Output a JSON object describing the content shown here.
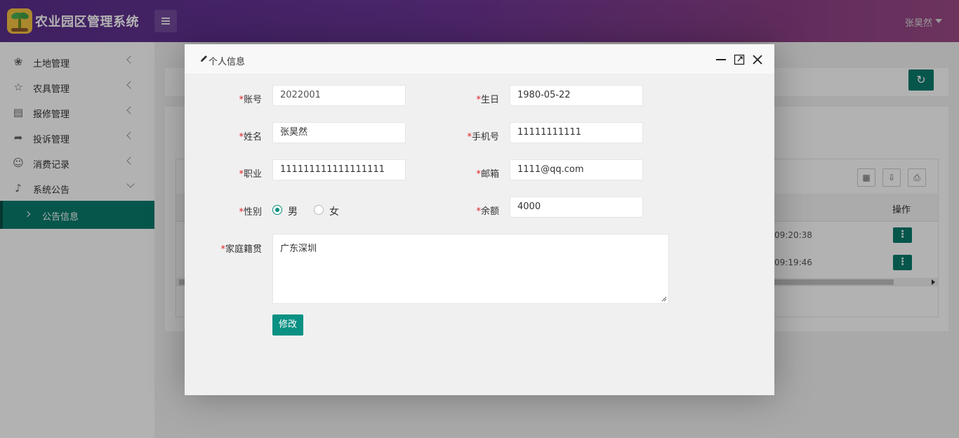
{
  "header": {
    "app_title": "农业园区管理系统",
    "user_name": "张昊然"
  },
  "sidebar": {
    "items": [
      {
        "label": "土地管理",
        "icon": "flower-icon"
      },
      {
        "label": "农具管理",
        "icon": "star-icon"
      },
      {
        "label": "报修管理",
        "icon": "report-icon"
      },
      {
        "label": "投诉管理",
        "icon": "share-arrow-icon"
      },
      {
        "label": "消费记录",
        "icon": "user-icon"
      },
      {
        "label": "系统公告",
        "icon": "speaker-icon"
      }
    ],
    "active_sub": "公告信息"
  },
  "background": {
    "table_header_op": "操作",
    "row_times": [
      "09:20:38",
      "09:19:46"
    ]
  },
  "modal": {
    "title": "个人信息",
    "fields": {
      "account": {
        "label": "账号",
        "value": "2022001"
      },
      "birthday": {
        "label": "生日",
        "value": "1980-05-22"
      },
      "name": {
        "label": "姓名",
        "value": "张昊然"
      },
      "phone": {
        "label": "手机号",
        "value": "11111111111"
      },
      "job": {
        "label": "职业",
        "value": "111111111111111111"
      },
      "email": {
        "label": "邮箱",
        "value": "1111@qq.com"
      },
      "gender": {
        "label": "性别",
        "options": [
          "男",
          "女"
        ],
        "selected": "男"
      },
      "balance": {
        "label": "余额",
        "value": "4000"
      },
      "hometown": {
        "label": "家庭籍贯",
        "value": "广东深圳"
      }
    },
    "submit_label": "修改"
  },
  "colors": {
    "accent": "#0a9183",
    "header_start": "#5b2f8c",
    "header_end": "#9b4a86"
  }
}
